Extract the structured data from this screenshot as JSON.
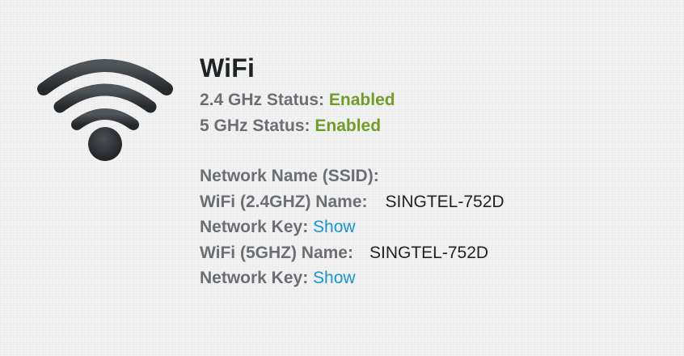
{
  "wifi": {
    "title": "WiFi",
    "status_24_label": "2.4 GHz Status:",
    "status_24_value": "Enabled",
    "status_5_label": "5 GHz Status:",
    "status_5_value": "Enabled",
    "network_name_label": "Network Name (SSID):",
    "wifi_24_name_label": "WiFi (2.4GHZ) Name:",
    "wifi_24_name_value": "SINGTEL-752D",
    "network_key_24_label": "Network Key:",
    "network_key_24_link": "Show",
    "wifi_5_name_label": "WiFi (5GHZ) Name:",
    "wifi_5_name_value": "SINGTEL-752D",
    "network_key_5_label": "Network Key:",
    "network_key_5_link": "Show"
  },
  "icons": {
    "wifi": "wifi-icon"
  },
  "colors": {
    "enabled": "#6f9d2a",
    "link": "#1a93cf",
    "label": "#6b6f73",
    "title": "#1e2326",
    "icon": "#2c3033"
  }
}
